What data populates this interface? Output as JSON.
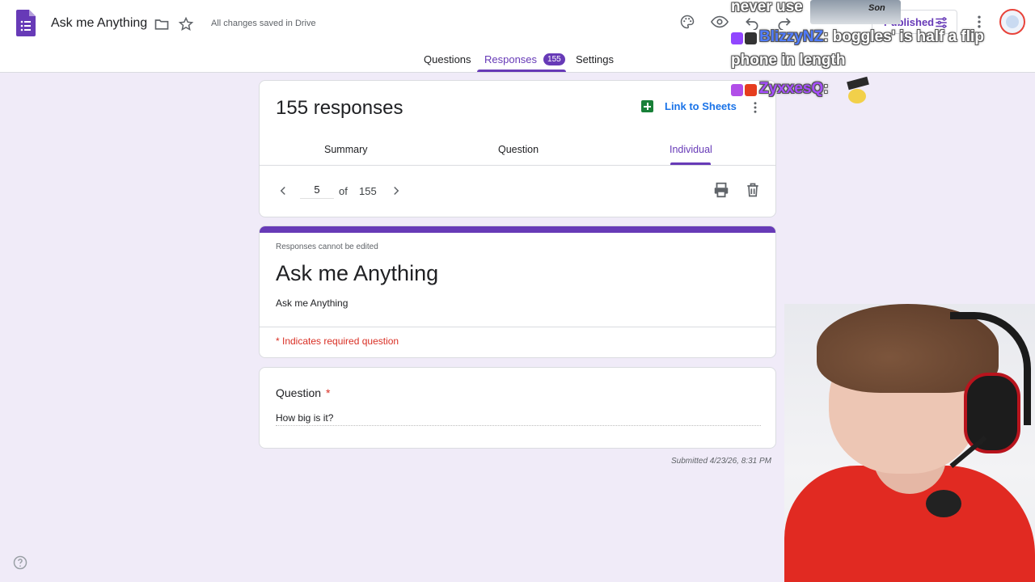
{
  "app": {
    "doc_title": "Ask me Anything",
    "saved_status": "All changes saved in Drive",
    "publish_label": "Published",
    "accent": "#673ab7"
  },
  "tabs": [
    {
      "label": "Questions"
    },
    {
      "label": "Responses",
      "badge": "155"
    },
    {
      "label": "Settings"
    }
  ],
  "responses": {
    "heading": "155 responses",
    "link_sheets": "Link to Sheets",
    "subtabs": [
      "Summary",
      "Question",
      "Individual"
    ],
    "pager": {
      "current": "5",
      "of_label": "of",
      "total": "155"
    }
  },
  "form": {
    "no_edit_note": "Responses cannot be edited",
    "title": "Ask me Anything",
    "description": "Ask me Anything",
    "required_note": "* Indicates required question"
  },
  "question": {
    "label": "Question",
    "required_mark": "*",
    "answer": "How big is it?"
  },
  "submitted": "Submitted 4/23/26, 8:31 PM",
  "stream_chat": {
    "line0": "never use",
    "emote_text": "Son",
    "user1": "BlizzyNZ",
    "msg1a": ": boggles' is half a flip",
    "msg1b": "phone in length",
    "user2": "ZyxxesQ",
    "msg2": ":"
  },
  "icons": {
    "forms_logo": "google-forms-logo",
    "folder": "folder-icon",
    "star": "star-icon",
    "palette": "palette-icon",
    "preview": "eye-icon",
    "undo": "undo-icon",
    "redo": "redo-icon",
    "more": "more-vert-icon",
    "print": "print-icon",
    "delete": "trash-icon",
    "help": "help-icon"
  }
}
